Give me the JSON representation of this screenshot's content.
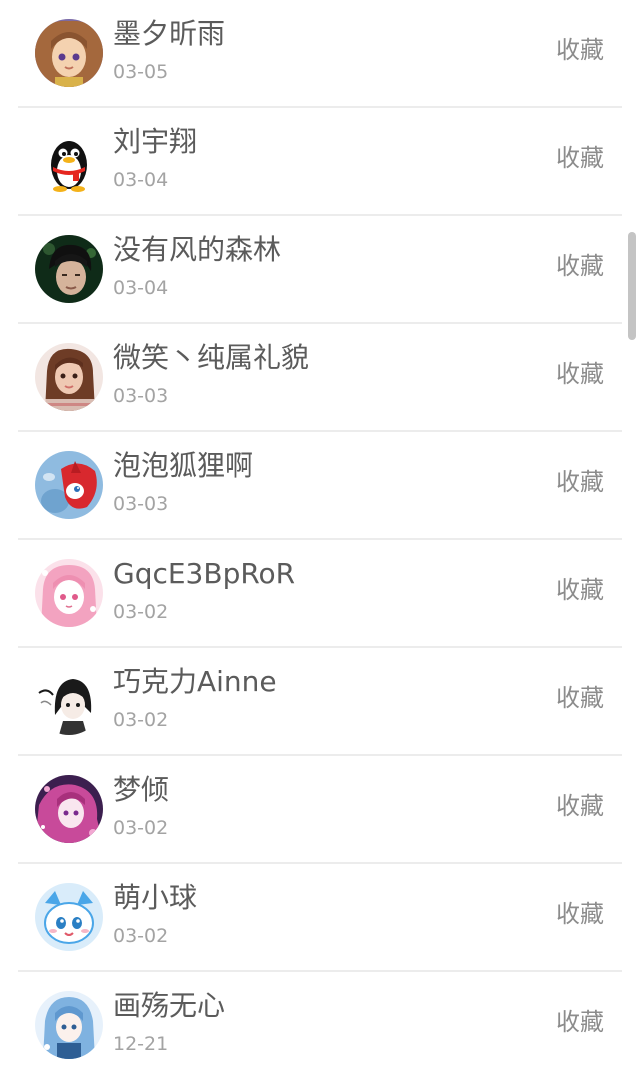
{
  "list": {
    "items": [
      {
        "name": "墨夕昕雨",
        "date": "03-05",
        "action": "收藏",
        "avatar_icon": "anime-girl-avatar-icon",
        "colors": [
          "#f4d2b0",
          "#a4683d",
          "#7b6ba8"
        ]
      },
      {
        "name": "刘宇翔",
        "date": "03-04",
        "action": "收藏",
        "avatar_icon": "qq-penguin-avatar-icon",
        "colors": [
          "#ffffff",
          "#111111",
          "#e5261f"
        ]
      },
      {
        "name": "没有风的森林",
        "date": "03-04",
        "action": "收藏",
        "avatar_icon": "dark-portrait-avatar-icon",
        "colors": [
          "#0f2b18",
          "#3a6b3a",
          "#d5b39b"
        ]
      },
      {
        "name": "微笑丶纯属礼貌",
        "date": "03-03",
        "action": "收藏",
        "avatar_icon": "girl-portrait-avatar-icon",
        "colors": [
          "#f2e6e2",
          "#6e3c26",
          "#efc9b3"
        ]
      },
      {
        "name": "泡泡狐狸啊",
        "date": "03-03",
        "action": "收藏",
        "avatar_icon": "red-fox-avatar-icon",
        "colors": [
          "#8fbbe0",
          "#d8282e",
          "#ffffff"
        ]
      },
      {
        "name": "GqcE3BpRoR",
        "date": "03-02",
        "action": "收藏",
        "avatar_icon": "pink-anime-avatar-icon",
        "colors": [
          "#fbe1ea",
          "#f3a3c0",
          "#ffffff"
        ]
      },
      {
        "name": "巧克力Ainne",
        "date": "03-02",
        "action": "收藏",
        "avatar_icon": "sketch-girl-avatar-icon",
        "colors": [
          "#ffffff",
          "#1a1a1a",
          "#888888"
        ]
      },
      {
        "name": "梦倾",
        "date": "03-02",
        "action": "收藏",
        "avatar_icon": "purple-anime-avatar-icon",
        "colors": [
          "#3c1f4f",
          "#c84a9a",
          "#f2a8d2"
        ]
      },
      {
        "name": "萌小球",
        "date": "03-02",
        "action": "收藏",
        "avatar_icon": "blue-cartoon-avatar-icon",
        "colors": [
          "#d9ecfa",
          "#4aa6e8",
          "#ffffff"
        ]
      },
      {
        "name": "画殇无心",
        "date": "12-21",
        "action": "收藏",
        "avatar_icon": "blue-hair-anime-avatar-icon",
        "colors": [
          "#e7f1fb",
          "#7fb2e0",
          "#2e5e94"
        ]
      }
    ]
  }
}
